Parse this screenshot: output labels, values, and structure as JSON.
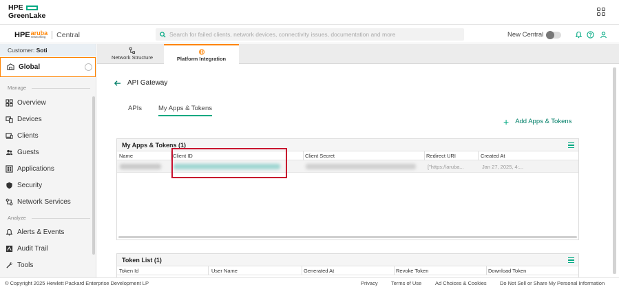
{
  "greenlake": {
    "logo_line1": "HPE",
    "logo_line2": "GreenLake"
  },
  "header": {
    "brand_hpe": "HPE",
    "brand_aruba": "aruba",
    "brand_aruba_sub": "networking",
    "brand_product": "Central",
    "search_placeholder": "Search for failed clients, network devices, connectivity issues, documentation and more",
    "new_central_label": "New Central",
    "new_central_enabled": false
  },
  "sidebar": {
    "customer_label": "Customer:",
    "customer_name": "Soti",
    "scope": "Global",
    "section_manage": "Manage",
    "manage_items": [
      {
        "label": "Overview",
        "icon": "overview-grid-icon"
      },
      {
        "label": "Devices",
        "icon": "devices-icon"
      },
      {
        "label": "Clients",
        "icon": "clients-icon"
      },
      {
        "label": "Guests",
        "icon": "guests-icon"
      },
      {
        "label": "Applications",
        "icon": "applications-icon"
      },
      {
        "label": "Security",
        "icon": "shield-icon"
      },
      {
        "label": "Network Services",
        "icon": "network-services-icon"
      }
    ],
    "section_analyze": "Analyze",
    "analyze_items": [
      {
        "label": "Alerts & Events",
        "icon": "bell-icon"
      },
      {
        "label": "Audit Trail",
        "icon": "audit-trail-icon"
      },
      {
        "label": "Tools",
        "icon": "wrench-icon"
      }
    ]
  },
  "tabs": [
    {
      "label": "Network Structure",
      "icon": "network-structure-icon",
      "active": false
    },
    {
      "label": "Platform Integration",
      "icon": "globe-icon",
      "active": true
    }
  ],
  "page": {
    "title": "API Gateway",
    "subtabs": [
      {
        "label": "APIs",
        "active": false
      },
      {
        "label": "My Apps & Tokens",
        "active": true
      }
    ],
    "add_link": "Add Apps & Tokens"
  },
  "apps_table": {
    "title": "My Apps & Tokens (1)",
    "columns": [
      "Name",
      "Client ID",
      "Client Secret",
      "Redirect URI",
      "Created At"
    ],
    "rows": [
      {
        "redirect_uri": "[\"https://aruba...",
        "created_at": "Jan 27, 2025, 4:..."
      }
    ]
  },
  "token_table": {
    "title": "Token List (1)",
    "columns": [
      "Token Id",
      "User Name",
      "Generated At",
      "Revoke Token",
      "Download Token"
    ]
  },
  "footer": {
    "copyright": "© Copyright 2025 Hewlett Packard Enterprise Development LP",
    "links": [
      "Privacy",
      "Terms of Use",
      "Ad Choices & Cookies",
      "Do Not Sell or Share My Personal Information"
    ]
  },
  "colors": {
    "accent_orange": "#ff8300",
    "accent_green": "#01a982",
    "highlight_red": "#c8102e"
  }
}
